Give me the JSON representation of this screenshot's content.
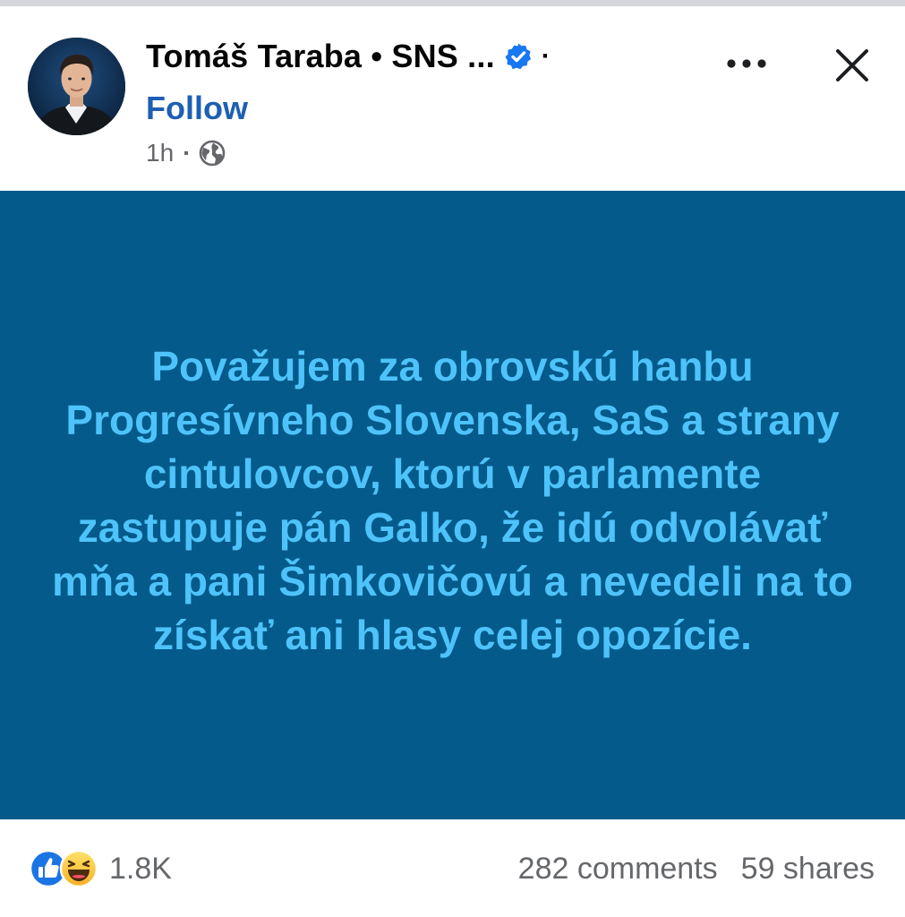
{
  "post": {
    "author": {
      "name": "Tomáš Taraba • SNS ...",
      "trailing_dot": "·",
      "verified": true,
      "verified_icon": "verified-badge-icon"
    },
    "follow_label": "Follow",
    "timestamp": "1h",
    "meta_separator": "·",
    "audience_icon": "globe-icon",
    "more_icon": "more-options-icon",
    "close_icon": "close-icon",
    "body_text": "Považujem za obrovskú hanbu Progresívneho Slovenska, SaS a strany cintulovcov, ktorú v parlamente zastupuje pán Galko, že idú odvolávať mňa a pani Šimkovičovú a nevedeli na to získať ani hlasy celej opozície.",
    "card_colors": {
      "background": "#045a8a",
      "text": "#4ec3fa"
    }
  },
  "engagement": {
    "reaction_icons": [
      "like-icon",
      "haha-icon"
    ],
    "reaction_count": "1.8K",
    "comments": "282 comments",
    "shares": "59 shares"
  },
  "colors": {
    "follow": "#1d5fb3",
    "verified": "#1877f2",
    "secondary_text": "#65676b"
  }
}
